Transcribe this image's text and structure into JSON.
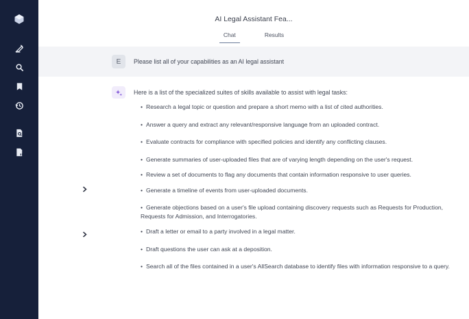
{
  "header": {
    "title": "AI Legal Assistant Fea...",
    "tabs": [
      {
        "label": "Chat",
        "active": true
      },
      {
        "label": "Results",
        "active": false
      }
    ]
  },
  "sidebar": {
    "icons": [
      "logo-icon",
      "pen-icon",
      "search-icon",
      "bookmark-icon",
      "history-icon",
      "document-search-icon",
      "document-quote-icon"
    ]
  },
  "user_message": {
    "avatar": "E",
    "text": "Please list all of your capabilities as an AI legal assistant"
  },
  "assistant_message": {
    "intro": "Here is a list of the specialized suites of skills available to assist with legal tasks:",
    "items": [
      "Research a legal topic or question and prepare a short memo with a list of cited authorities.",
      "Answer a query and extract any relevant/responsive language from an uploaded contract.",
      "Evaluate contracts for compliance with specified policies and identify any conflicting clauses.",
      "Generate summaries of user-uploaded files that are of varying length depending on the user's request.",
      "Review a set of documents to flag any documents that contain information responsive to user queries.",
      "Generate a timeline of events from user-uploaded documents.",
      "Generate objections based on a user's file upload containing discovery requests such as Requests for Production, Requests for Admission, and Interrogatories.",
      "Draft a letter or email to a party involved in a legal matter.",
      "Draft questions the user can ask at a deposition.",
      "Search all of the files contained in a user's AllSearch database to identify files with information responsive to a query."
    ]
  },
  "colors": {
    "sidebar": "#16203a",
    "ai_accent": "#7b4fd6"
  }
}
